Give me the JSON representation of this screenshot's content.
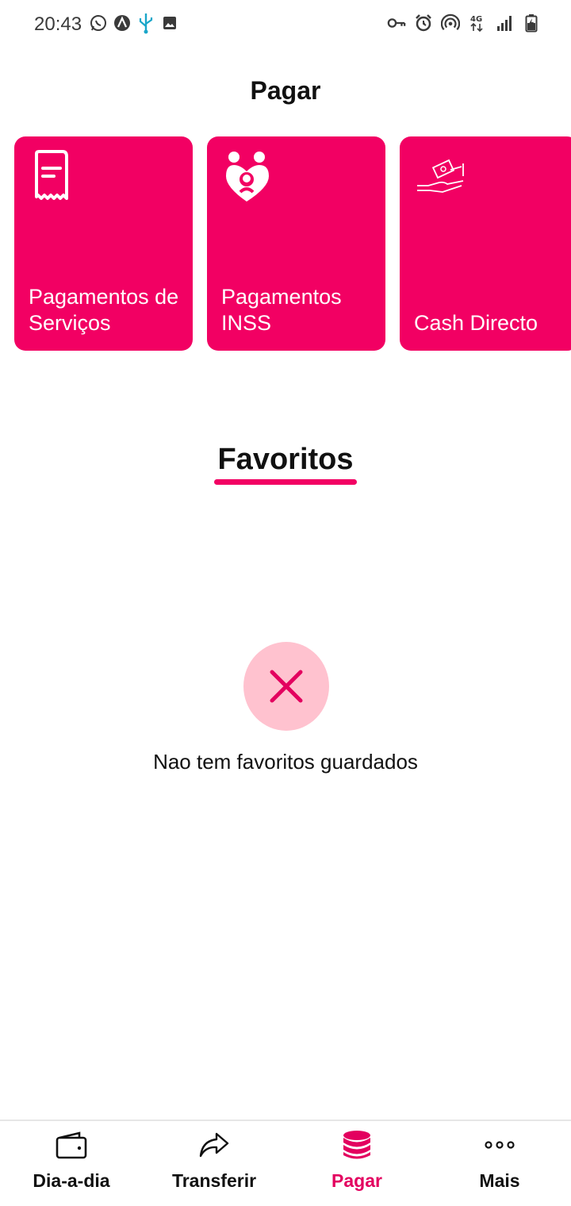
{
  "status_bar": {
    "time": "20:43",
    "left_icons": [
      "whatsapp-icon",
      "a-badge-icon",
      "usb-icon",
      "image-icon"
    ],
    "right_icons": [
      "vpn-key-icon",
      "alarm-icon",
      "hotspot-icon",
      "network-4g-icon",
      "signal-icon",
      "battery-charging-icon"
    ],
    "network_label": "4G"
  },
  "header": {
    "title": "Pagar"
  },
  "cards": [
    {
      "label": "Pagamentos de Serviços",
      "icon": "receipt-icon"
    },
    {
      "label": "Pagamentos INSS",
      "icon": "family-heart-icon"
    },
    {
      "label": "Cash Directo",
      "icon": "cash-hand-icon"
    }
  ],
  "favorites": {
    "title": "Favoritos",
    "empty_message": "Nao tem favoritos guardados",
    "empty_icon": "close-icon"
  },
  "bottom_nav": {
    "items": [
      {
        "label": "Dia-a-dia",
        "icon": "wallet-icon",
        "active": false
      },
      {
        "label": "Transferir",
        "icon": "share-arrow-icon",
        "active": false
      },
      {
        "label": "Pagar",
        "icon": "coins-stack-icon",
        "active": true
      },
      {
        "label": "Mais",
        "icon": "more-dots-icon",
        "active": false
      }
    ]
  },
  "colors": {
    "accent": "#f20063",
    "accent_light": "#ffc2cf",
    "text": "#111111"
  }
}
